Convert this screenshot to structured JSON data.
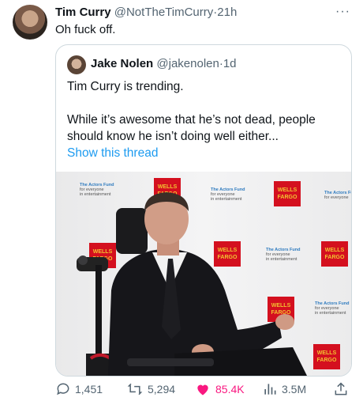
{
  "tweet": {
    "author_name": "Tim Curry",
    "author_handle": "@NotTheTimCurry",
    "separator": "·",
    "time": "21h",
    "text": "Oh fuck off."
  },
  "quote": {
    "author_name": "Jake Nolen",
    "author_handle": "@jakenolen",
    "separator": "·",
    "time": "1d",
    "text_line1": "Tim Curry is trending.",
    "text_line2": "While it’s awesome that he’s not dead, people should know he isn’t doing well either...",
    "show_thread": "Show this thread"
  },
  "backdrop": {
    "wells_fargo": "WELLS FARGO",
    "actors_fund": "The Actors Fund",
    "actors_fund_line2": "for everyone",
    "actors_fund_line3": "in entertainment"
  },
  "actions": {
    "replies": "1,451",
    "retweets": "5,294",
    "likes": "85.4K",
    "views": "3.5M"
  },
  "colors": {
    "like_accent": "#f91880",
    "link": "#1d9bf0",
    "muted": "#536471"
  },
  "icons": [
    "more-icon",
    "reply-icon",
    "retweet-icon",
    "like-icon",
    "views-icon",
    "share-icon"
  ]
}
